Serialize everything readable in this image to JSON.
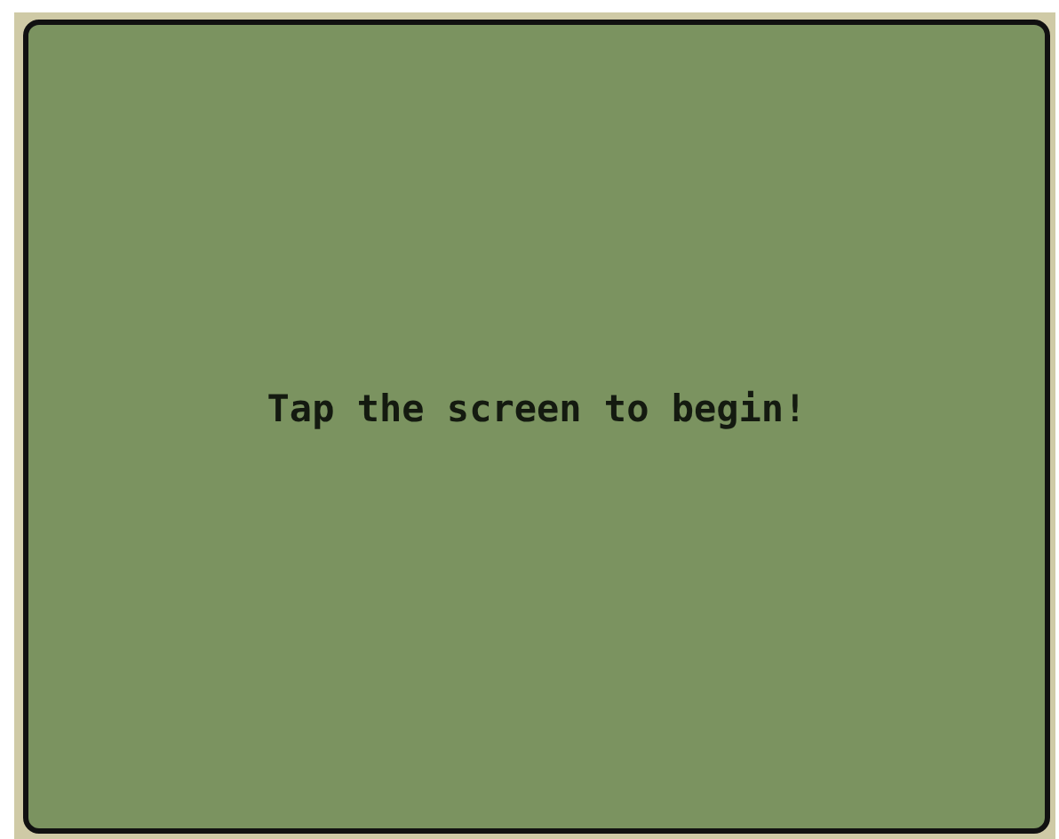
{
  "screen": {
    "message": "Tap the screen to begin!"
  }
}
